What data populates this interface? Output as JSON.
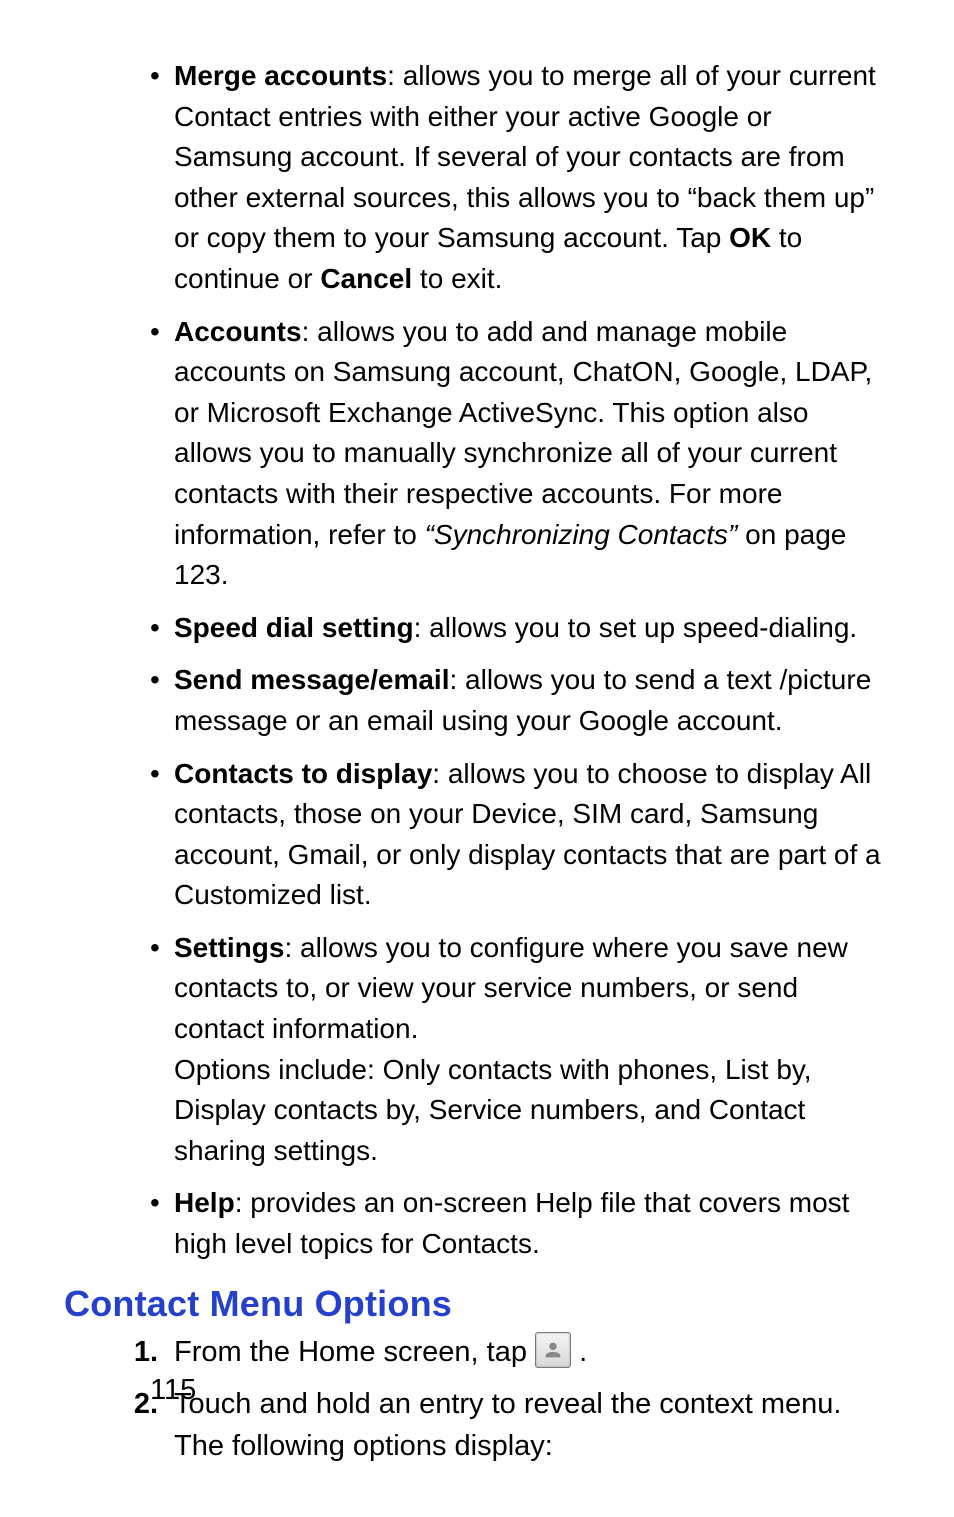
{
  "bullets": [
    {
      "term": "Merge accounts",
      "pre": ": allows you to merge all of your current Contact entries with either your active Google or Samsung account. If several of your contacts are from other external sources, this allows you to “back them up” or copy them to your Samsung account. Tap ",
      "b1": "OK",
      "mid": " to continue or ",
      "b2": "Cancel",
      "post": " to exit."
    },
    {
      "term": "Accounts",
      "pre": ": allows you to add and manage mobile accounts on Samsung account, ChatON, Google, LDAP, or Microsoft Exchange ActiveSync. This option also allows you to manually synchronize all of your current contacts with their respective accounts. For more information, refer to ",
      "ref": "“Synchronizing Contacts”",
      "post": "  on page 123."
    },
    {
      "term": "Speed dial setting",
      "pre": ": allows you to set up speed-dialing."
    },
    {
      "term": "Send message/email",
      "pre": ": allows you to send a text /picture message or an email using your Google account."
    },
    {
      "term": "Contacts to display",
      "pre": ": allows you to choose to display All contacts, those on your Device, SIM card, Samsung account, Gmail, or only display contacts that are part of a Customized list."
    },
    {
      "term": "Settings",
      "pre": ": allows you to configure where you save new contacts to, or view your service numbers, or send contact information.",
      "line2": "Options include: Only contacts with phones, List by, Display contacts by, Service numbers, and Contact sharing settings."
    },
    {
      "term": "Help",
      "pre": ": provides an on-screen Help file that covers most high level topics for Contacts."
    }
  ],
  "heading": "Contact Menu Options",
  "steps": {
    "s1": {
      "num": "1.",
      "pre": "From the Home screen, tap ",
      "post": " ."
    },
    "s2": {
      "num": "2.",
      "text": "Touch and hold an entry to reveal the context menu. The following options display:"
    }
  },
  "pageNumber": "115"
}
